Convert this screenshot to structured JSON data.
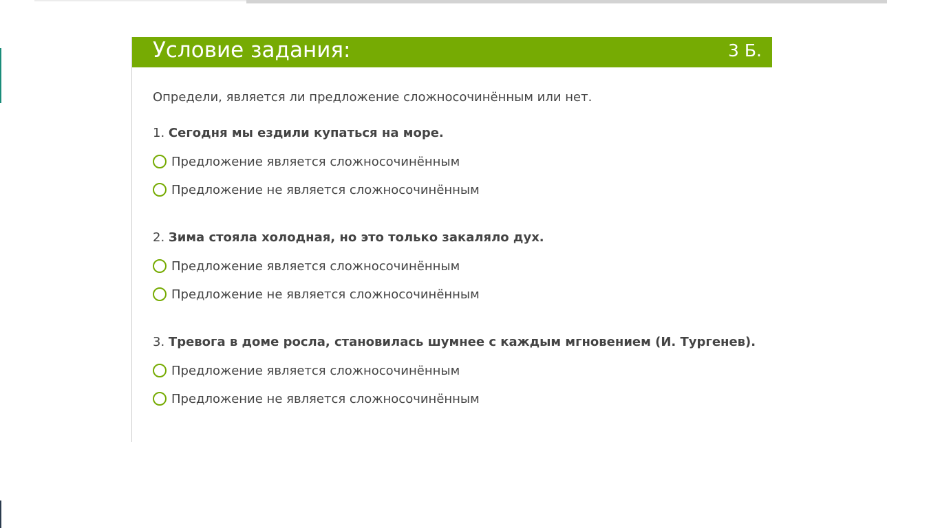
{
  "header": {
    "title": "Условие задания:",
    "score": "3 Б."
  },
  "instruction": "Определи, является ли предложение сложносочинённым или нет.",
  "questions": [
    {
      "number": "1.",
      "text": "Сегодня мы ездили купаться на море.",
      "options": [
        "Предложение является сложносочинённым",
        "Предложение не является сложносочинённым"
      ]
    },
    {
      "number": "2.",
      "text": "Зима стояла холодная, но это только закаляло дух.",
      "options": [
        "Предложение является сложносочинённым",
        "Предложение не является сложносочинённым"
      ]
    },
    {
      "number": "3.",
      "text": "Тревога в доме росла, становилась шумнее с каждым мгновением (И. Тургенев).",
      "options": [
        "Предложение является сложносочинённым",
        "Предложение не является сложносочинённым"
      ]
    }
  ],
  "colors": {
    "accent": "#76ab03",
    "text": "#444444"
  }
}
